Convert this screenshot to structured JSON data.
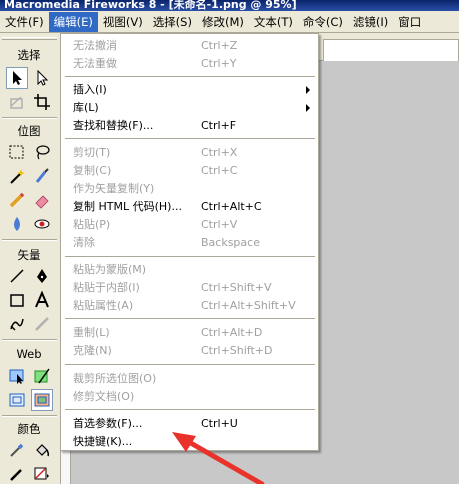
{
  "window": {
    "title": "Macromedia Fireworks 8 - [未命名-1.png @ 95%]"
  },
  "menubar": [
    {
      "label": "文件(F)"
    },
    {
      "label": "编辑(E)"
    },
    {
      "label": "视图(V)"
    },
    {
      "label": "选择(S)"
    },
    {
      "label": "修改(M)"
    },
    {
      "label": "文本(T)"
    },
    {
      "label": "命令(C)"
    },
    {
      "label": "滤镜(I)"
    },
    {
      "label": "窗口"
    }
  ],
  "tools": {
    "sections": [
      "选择",
      "位图",
      "矢量",
      "Web",
      "颜色"
    ]
  },
  "edit_menu": {
    "items": [
      {
        "label": "无法撤消",
        "shortcut": "Ctrl+Z",
        "disabled": true
      },
      {
        "label": "无法重做",
        "shortcut": "Ctrl+Y",
        "disabled": true
      },
      {
        "label": "插入(I)",
        "shortcut": "",
        "submenu": true
      },
      {
        "label": "库(L)",
        "shortcut": "",
        "submenu": true
      },
      {
        "label": "查找和替换(F)...",
        "shortcut": "Ctrl+F"
      },
      {
        "label": "剪切(T)",
        "shortcut": "Ctrl+X",
        "disabled": true
      },
      {
        "label": "复制(C)",
        "shortcut": "Ctrl+C",
        "disabled": true
      },
      {
        "label": "作为矢量复制(Y)",
        "shortcut": "",
        "disabled": true
      },
      {
        "label": "复制 HTML 代码(H)...",
        "shortcut": "Ctrl+Alt+C"
      },
      {
        "label": "粘贴(P)",
        "shortcut": "Ctrl+V",
        "disabled": true
      },
      {
        "label": "清除",
        "shortcut": "Backspace",
        "disabled": true
      },
      {
        "label": "粘贴为蒙版(M)",
        "shortcut": "",
        "disabled": true
      },
      {
        "label": "粘贴于内部(I)",
        "shortcut": "Ctrl+Shift+V",
        "disabled": true
      },
      {
        "label": "粘贴属性(A)",
        "shortcut": "Ctrl+Alt+Shift+V",
        "disabled": true
      },
      {
        "label": "重制(L)",
        "shortcut": "Ctrl+Alt+D",
        "disabled": true
      },
      {
        "label": "克隆(N)",
        "shortcut": "Ctrl+Shift+D",
        "disabled": true
      },
      {
        "label": "裁剪所选位图(O)",
        "shortcut": "",
        "disabled": true
      },
      {
        "label": "修剪文档(O)",
        "shortcut": "",
        "disabled": true
      },
      {
        "label": "首选参数(F)...",
        "shortcut": "Ctrl+U"
      },
      {
        "label": "快捷键(K)...",
        "shortcut": ""
      }
    ]
  },
  "colors": {
    "menu_highlight": "#316ac5",
    "disabled_text": "#a0a0a0",
    "annotation_arrow": "#e8322a"
  }
}
